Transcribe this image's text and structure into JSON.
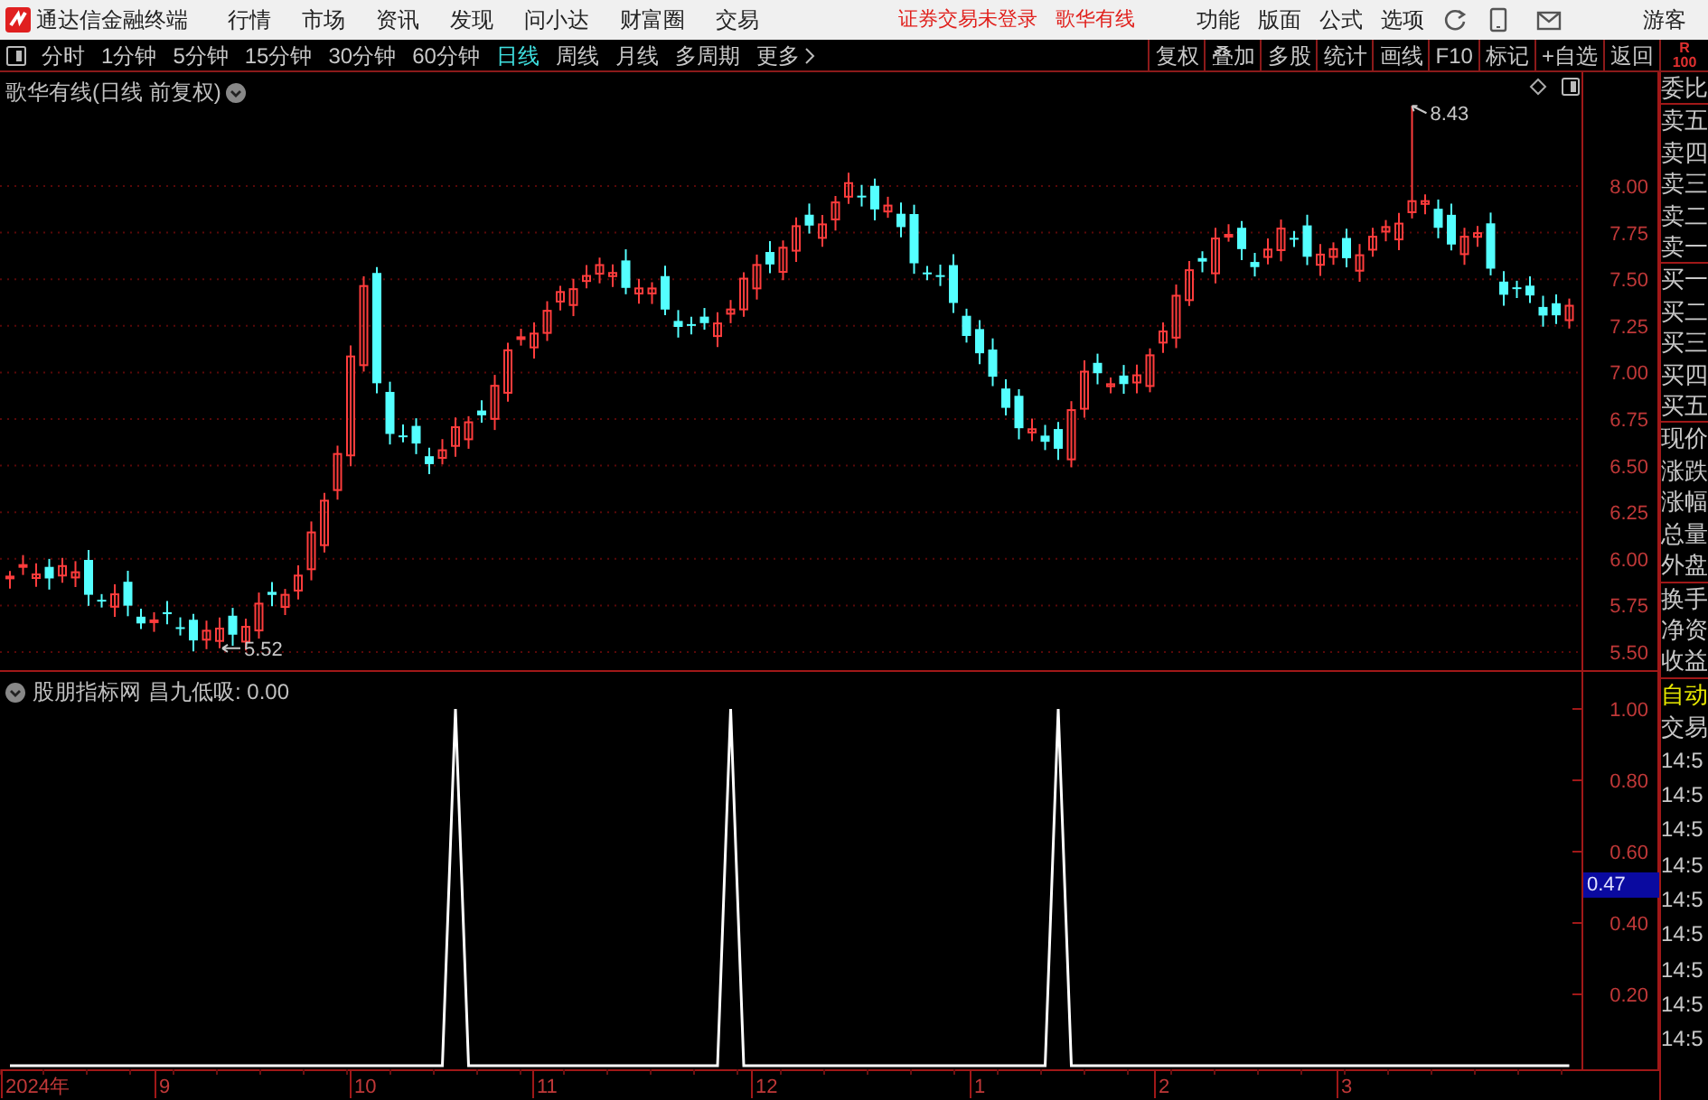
{
  "window": {
    "title": "通达信金融终端"
  },
  "menu": [
    "行情",
    "市场",
    "资讯",
    "发现",
    "问小达",
    "财富圈",
    "交易"
  ],
  "notices": [
    "证券交易未登录",
    "歌华有线"
  ],
  "tools": [
    "功能",
    "版面",
    "公式",
    "选项"
  ],
  "user": "游客",
  "periods": [
    {
      "label": "分时",
      "selected": false
    },
    {
      "label": "1分钟",
      "selected": false
    },
    {
      "label": "5分钟",
      "selected": false
    },
    {
      "label": "15分钟",
      "selected": false
    },
    {
      "label": "30分钟",
      "selected": false
    },
    {
      "label": "60分钟",
      "selected": false
    },
    {
      "label": "日线",
      "selected": true
    },
    {
      "label": "周线",
      "selected": false
    },
    {
      "label": "月线",
      "selected": false
    },
    {
      "label": "多周期",
      "selected": false
    },
    {
      "label": "更多",
      "selected": false
    }
  ],
  "chart_buttons": [
    "复权",
    "叠加",
    "多股",
    "统计",
    "画线",
    "F10",
    "标记",
    "+自选",
    "返回"
  ],
  "corner": [
    "R",
    "100"
  ],
  "price_panel": {
    "title": "歌华有线(日线 前复权)",
    "ticks": [
      "8.00",
      "7.75",
      "7.50",
      "7.25",
      "7.00",
      "6.75",
      "6.50",
      "6.25",
      "6.00",
      "5.75",
      "5.50"
    ],
    "high_label": "8.43",
    "low_label": "5.52"
  },
  "indicator_panel": {
    "source": "股朋指标网",
    "title": "昌九低吸: 0.00",
    "cursor_value": "0.47",
    "ticks": [
      "1.00",
      "0.80",
      "0.60",
      "0.40",
      "0.20"
    ]
  },
  "x_axis": [
    "2024年",
    "9",
    "10",
    "11",
    "12",
    "1",
    "2",
    "3"
  ],
  "quote_panel": {
    "groups": [
      [
        "委比"
      ],
      [
        "卖五",
        "卖四",
        "卖三",
        "卖二",
        "卖一"
      ],
      [
        "买一",
        "买二",
        "买三",
        "买四",
        "买五"
      ],
      [
        "现价",
        "涨跌",
        "涨幅",
        "总量",
        "外盘"
      ],
      [
        "换手",
        "净资",
        "收益"
      ]
    ],
    "modes": [
      {
        "label": "自动",
        "selected": true
      },
      {
        "label": "交易",
        "selected": false
      }
    ],
    "times": [
      "14:5",
      "14:5",
      "14:5",
      "14:5",
      "14:5",
      "14:5",
      "14:5",
      "14:5",
      "14:5"
    ]
  }
}
